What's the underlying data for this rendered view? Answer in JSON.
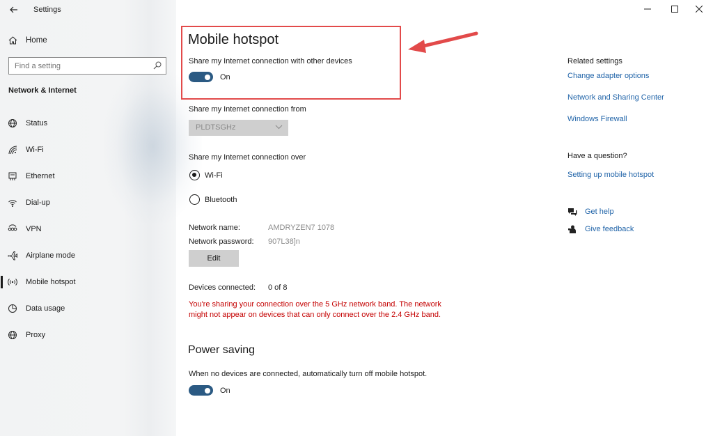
{
  "window": {
    "title": "Settings"
  },
  "sidebar": {
    "home_label": "Home",
    "search_placeholder": "Find a setting",
    "section_title": "Network & Internet",
    "items": [
      {
        "label": "Status",
        "icon": "globe-icon"
      },
      {
        "label": "Wi-Fi",
        "icon": "wifi-icon"
      },
      {
        "label": "Ethernet",
        "icon": "ethernet-icon"
      },
      {
        "label": "Dial-up",
        "icon": "dialup-icon"
      },
      {
        "label": "VPN",
        "icon": "vpn-icon"
      },
      {
        "label": "Airplane mode",
        "icon": "airplane-icon"
      },
      {
        "label": "Mobile hotspot",
        "icon": "hotspot-icon",
        "active": true
      },
      {
        "label": "Data usage",
        "icon": "data-usage-icon"
      },
      {
        "label": "Proxy",
        "icon": "globe-icon"
      }
    ]
  },
  "main": {
    "title": "Mobile hotspot",
    "share_label": "Share my Internet connection with other devices",
    "share_toggle": "On",
    "share_from_label": "Share my Internet connection from",
    "share_from_value": "PLDTSGHz",
    "share_over_label": "Share my Internet connection over",
    "share_over_options": [
      "Wi-Fi",
      "Bluetooth"
    ],
    "share_over_selected": "Wi-Fi",
    "network_name_label": "Network name:",
    "network_name_value": "AMDRYZEN7 1078",
    "network_password_label": "Network password:",
    "network_password_value": "907L38]n",
    "edit_label": "Edit",
    "devices_label": "Devices connected:",
    "devices_value": "0 of 8",
    "warning": "You're sharing your connection over the 5 GHz network band. The network might not appear on devices that can only connect over the 2.4 GHz band.",
    "power_title": "Power saving",
    "power_label": "When no devices are connected, automatically turn off mobile hotspot.",
    "power_toggle": "On"
  },
  "right": {
    "related_title": "Related settings",
    "links": [
      "Change adapter options",
      "Network and Sharing Center",
      "Windows Firewall"
    ],
    "question_title": "Have a question?",
    "question_link": "Setting up mobile hotspot",
    "get_help": "Get help",
    "give_feedback": "Give feedback"
  },
  "colors": {
    "accent": "#2b5a83",
    "link": "#1f63a8",
    "warning": "#c40000",
    "annotation": "#e24a4a"
  }
}
